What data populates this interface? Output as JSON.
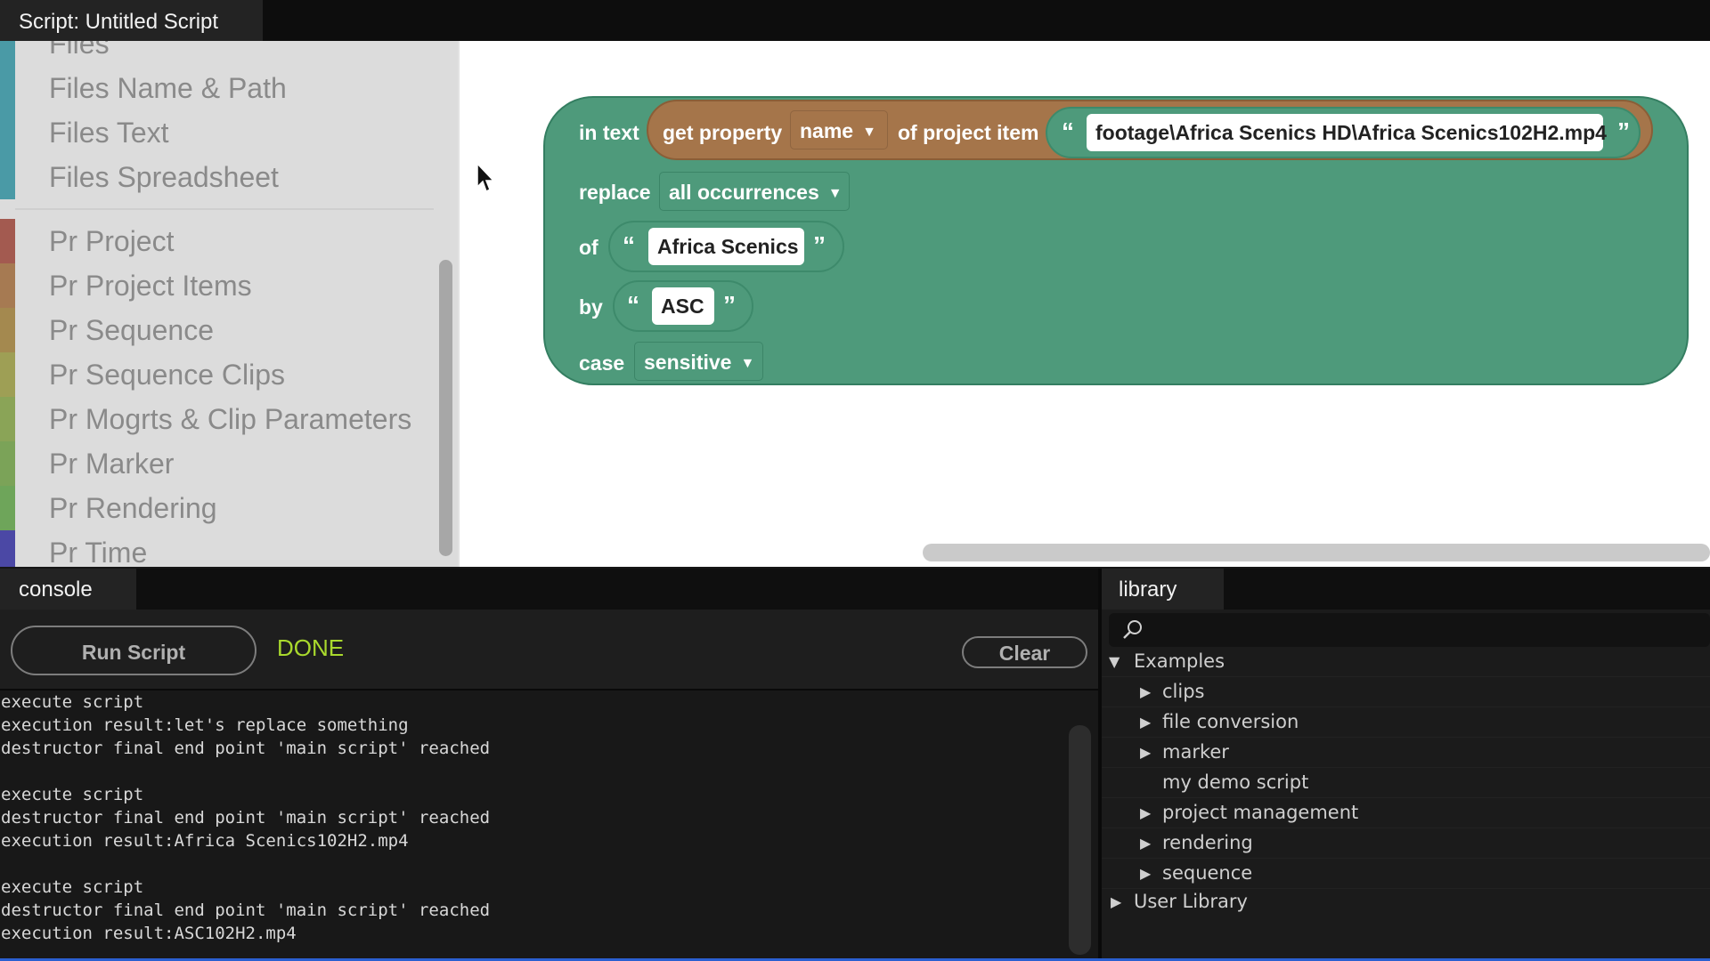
{
  "window": {
    "title": "Script: Untitled Script"
  },
  "sidebar": {
    "categories": [
      {
        "label": "Files",
        "color": "#4a9aa6"
      },
      {
        "label": "Files Name & Path",
        "color": "#4a9aa6"
      },
      {
        "label": "Files Text",
        "color": "#4a9aa6"
      },
      {
        "label": "Files Spreadsheet",
        "color": "#4a9aa6"
      },
      {
        "label": "Pr Project",
        "color": "#a35a50"
      },
      {
        "label": "Pr Project Items",
        "color": "#a67a52"
      },
      {
        "label": "Pr Sequence",
        "color": "#a4894f"
      },
      {
        "label": "Pr Sequence Clips",
        "color": "#9e9f55"
      },
      {
        "label": "Pr Mogrts & Clip Parameters",
        "color": "#8aa457"
      },
      {
        "label": "Pr Marker",
        "color": "#7ba358"
      },
      {
        "label": "Pr Rendering",
        "color": "#6ea55a"
      },
      {
        "label": "Pr Time",
        "color": "#4b48a5"
      }
    ]
  },
  "block": {
    "in_text_label": "in text",
    "get_property_label": "get property",
    "property_dropdown": "name",
    "of_project_item_label": "of project item",
    "item_path": "footage\\Africa Scenics HD\\Africa Scenics102H2.mp4",
    "replace_label": "replace",
    "replace_dropdown": "all occurrences",
    "of_label": "of",
    "search_text": "Africa Scenics",
    "by_label": "by",
    "replacement_text": "ASC",
    "case_label": "case",
    "case_dropdown": "sensitive",
    "open_quote": "“",
    "close_quote": "”",
    "colors": {
      "text_block": "#4e9a7b",
      "property_block": "#a5754a"
    }
  },
  "console": {
    "tab_label": "console",
    "run_button": "Run Script",
    "status": "DONE",
    "status_color": "#a9d92d",
    "clear_button": "Clear",
    "output": [
      [
        "execute script",
        "execution result:let's replace something",
        "destructor final end point 'main script' reached"
      ],
      [
        "execute script",
        "destructor final end point 'main script' reached",
        "execution result:Africa Scenics102H2.mp4"
      ],
      [
        "execute script",
        "destructor final end point 'main script' reached",
        "execution result:ASC102H2.mp4"
      ]
    ]
  },
  "library": {
    "tab_label": "library",
    "search": {
      "value": "",
      "placeholder": ""
    },
    "tree": {
      "examples_label": "Examples",
      "examples_items": [
        {
          "label": "clips",
          "expandable": true
        },
        {
          "label": "file conversion",
          "expandable": true
        },
        {
          "label": "marker",
          "expandable": true
        },
        {
          "label": "my demo script",
          "expandable": false
        },
        {
          "label": "project management",
          "expandable": true
        },
        {
          "label": "rendering",
          "expandable": true
        },
        {
          "label": "sequence",
          "expandable": true
        }
      ],
      "user_library_label": "User Library"
    }
  }
}
